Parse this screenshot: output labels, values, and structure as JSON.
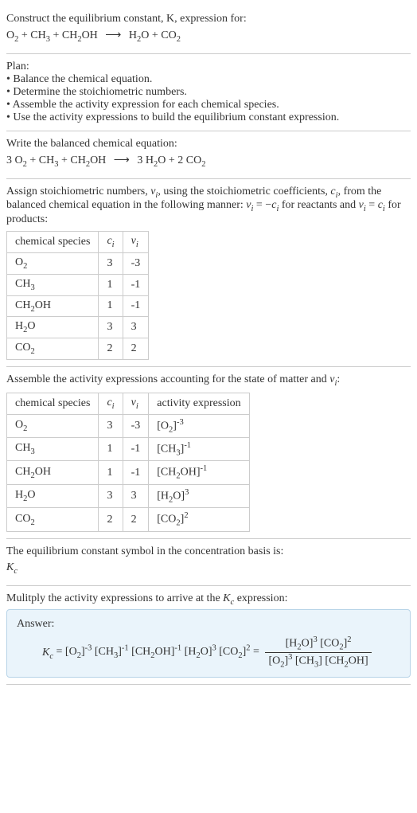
{
  "intro": {
    "line1": "Construct the equilibrium constant, K, expression for:"
  },
  "plan": {
    "heading": "Plan:",
    "b1": "• Balance the chemical equation.",
    "b2": "• Determine the stoichiometric numbers.",
    "b3": "• Assemble the activity expression for each chemical species.",
    "b4": "• Use the activity expressions to build the equilibrium constant expression."
  },
  "balanced": {
    "heading": "Write the balanced chemical equation:"
  },
  "assign": {
    "text_pre": "Assign stoichiometric numbers, ",
    "text_mid1": ", using the stoichiometric coefficients, ",
    "text_mid2": ", from the balanced chemical equation in the following manner: ",
    "text_mid3": " for reactants and ",
    "text_end": " for products:"
  },
  "table1": {
    "h1": "chemical species",
    "rows": [
      {
        "sp": "O2",
        "c": "3",
        "v": "-3"
      },
      {
        "sp": "CH3",
        "c": "1",
        "v": "-1"
      },
      {
        "sp": "CH2OH",
        "c": "1",
        "v": "-1"
      },
      {
        "sp": "H2O",
        "c": "3",
        "v": "3"
      },
      {
        "sp": "CO2",
        "c": "2",
        "v": "2"
      }
    ]
  },
  "assemble": {
    "text_pre": "Assemble the activity expressions accounting for the state of matter and ",
    "text_end": ":"
  },
  "table2": {
    "h1": "chemical species",
    "h4": "activity expression",
    "rows": [
      {
        "c": "3",
        "v": "-3"
      },
      {
        "c": "1",
        "v": "-1"
      },
      {
        "c": "1",
        "v": "-1"
      },
      {
        "c": "3",
        "v": "3"
      },
      {
        "c": "2",
        "v": "2"
      }
    ]
  },
  "ksymbol": {
    "line": "The equilibrium constant symbol in the concentration basis is:"
  },
  "multiply": {
    "text_pre": "Mulitply the activity expressions to arrive at the ",
    "text_end": " expression:"
  },
  "answer": {
    "label": "Answer:"
  }
}
